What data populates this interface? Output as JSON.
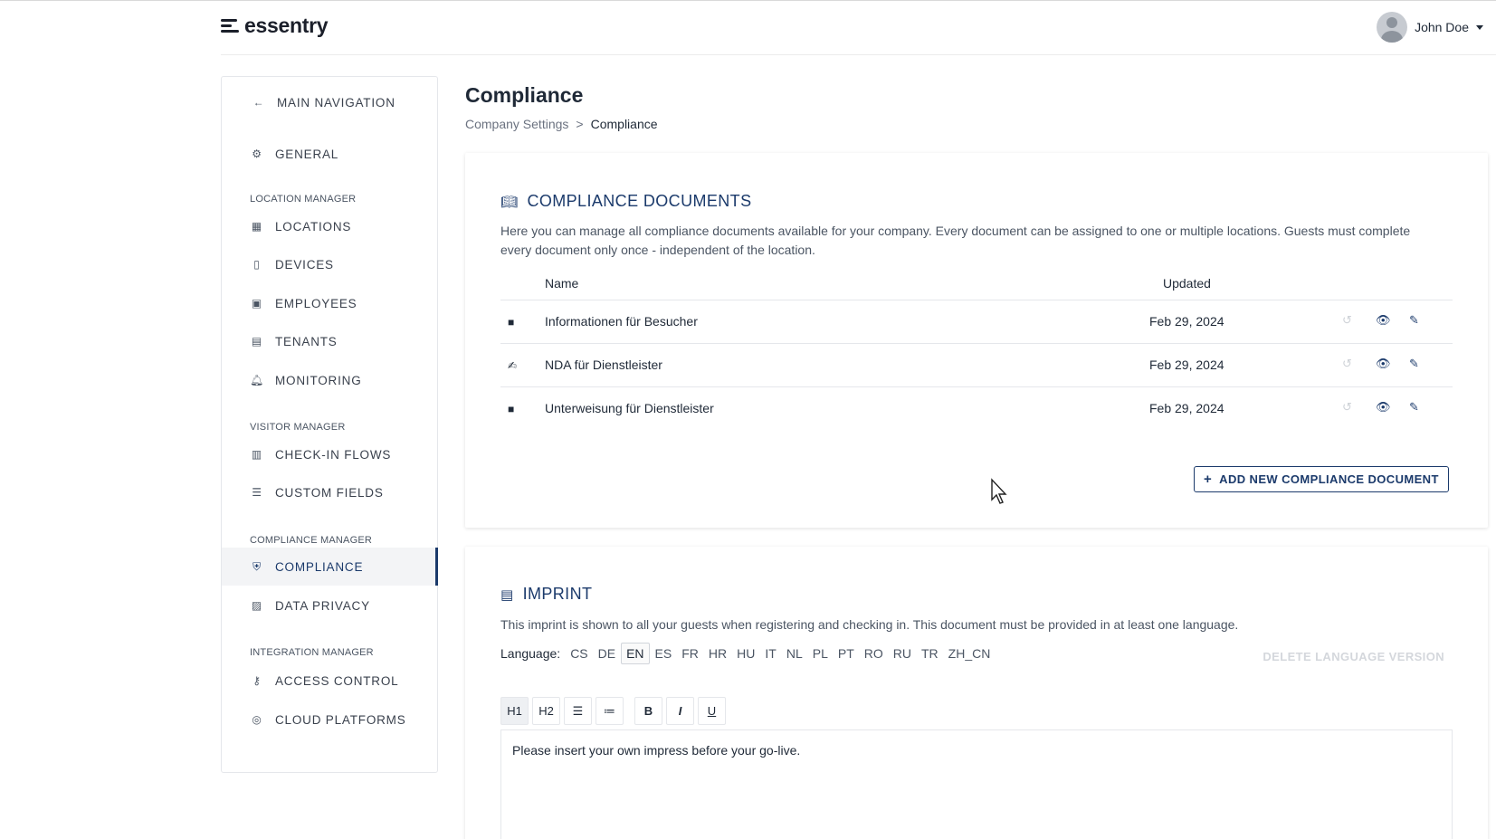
{
  "header": {
    "logo_text": "essentry",
    "user_name": "John Doe"
  },
  "sidebar": {
    "back_label": "MAIN NAVIGATION",
    "general_label": "GENERAL",
    "sections": {
      "location": "LOCATION MANAGER",
      "visitor": "VISITOR MANAGER",
      "compliance": "COMPLIANCE MANAGER",
      "integration": "INTEGRATION MANAGER"
    },
    "items": {
      "locations": "LOCATIONS",
      "devices": "DEVICES",
      "employees": "EMPLOYEES",
      "tenants": "TENANTS",
      "monitoring": "MONITORING",
      "checkin_flows": "CHECK-IN FLOWS",
      "custom_fields": "CUSTOM FIELDS",
      "compliance": "COMPLIANCE",
      "data_privacy": "DATA PRIVACY",
      "access_control": "ACCESS CONTROL",
      "cloud_platforms": "CLOUD PLATFORMS"
    },
    "active_item": "compliance"
  },
  "page": {
    "title": "Compliance",
    "breadcrumb": [
      "Company Settings",
      ">",
      "Compliance"
    ]
  },
  "compliance_documents": {
    "title": "COMPLIANCE DOCUMENTS",
    "description": "Here you can manage all compliance documents available for your company. Every document can be assigned to one or multiple locations. Guests must complete every document only once - independent of the location.",
    "columns": {
      "name": "Name",
      "updated": "Updated"
    },
    "rows": [
      {
        "name": "Informationen für Besucher",
        "updated": "Feb 29, 2024",
        "icon": "video-icon"
      },
      {
        "name": "NDA für Dienstleister",
        "updated": "Feb 29, 2024",
        "icon": "signature-icon"
      },
      {
        "name": "Unterweisung für Dienstleister",
        "updated": "Feb 29, 2024",
        "icon": "video-icon"
      }
    ],
    "add_button": "ADD NEW COMPLIANCE DOCUMENT"
  },
  "imprint": {
    "title": "IMPRINT",
    "description": "This imprint is shown to all your guests when registering and checking in. This document must be provided in at least one language.",
    "language_label": "Language:",
    "languages": [
      "CS",
      "DE",
      "EN",
      "ES",
      "FR",
      "HR",
      "HU",
      "IT",
      "NL",
      "PL",
      "PT",
      "RO",
      "RU",
      "TR",
      "ZH_CN"
    ],
    "active_language": "EN",
    "delete_label": "DELETE LANGUAGE VERSION",
    "toolbar": {
      "h1": "H1",
      "h2": "H2",
      "bold": "B",
      "italic": "I",
      "underline": "U"
    },
    "content": "Please insert your own impress before your go-live."
  },
  "colors": {
    "accent": "#1b3a6b",
    "disabled": "#d4d7dc"
  }
}
